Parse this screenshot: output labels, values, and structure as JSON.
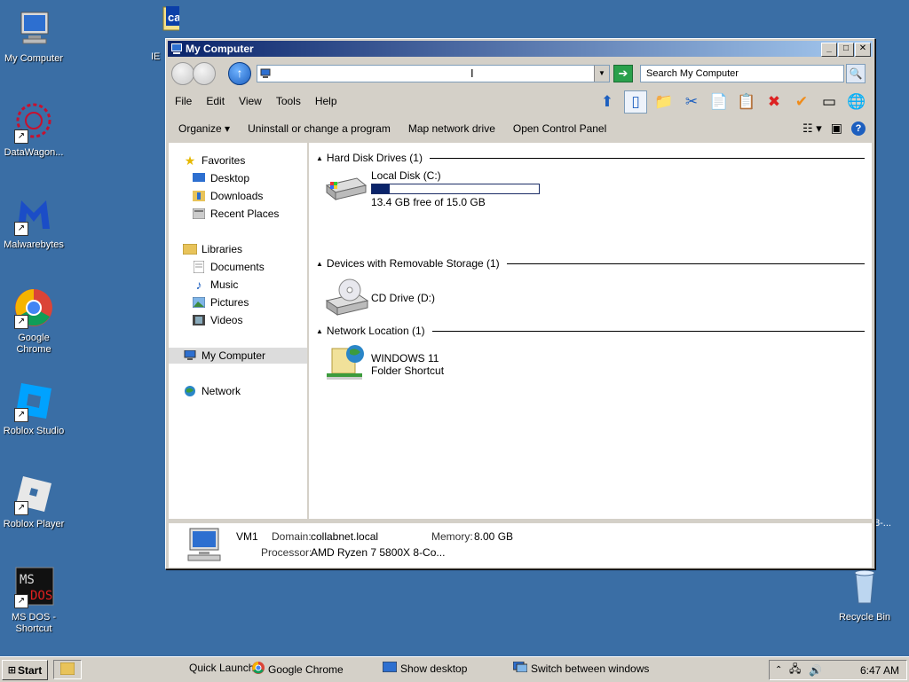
{
  "desktop": {
    "icons": [
      {
        "label": "My Computer"
      },
      {
        "label": "DataWagon..."
      },
      {
        "label": "Malwarebytes"
      },
      {
        "label": "Google Chrome"
      },
      {
        "label": "Roblox Studio"
      },
      {
        "label": "Roblox Player"
      },
      {
        "label": "MS DOS - Shortcut"
      },
      {
        "label": "IE"
      },
      {
        "label": "Recycle Bin"
      }
    ],
    "obscured_label": "8-..."
  },
  "window": {
    "title": "My Computer",
    "address": "",
    "search_placeholder": "Search My Computer",
    "menu": [
      "File",
      "Edit",
      "View",
      "Tools",
      "Help"
    ],
    "commands": [
      "Organize",
      "Uninstall or change a program",
      "Map network drive",
      "Open Control Panel"
    ],
    "nav": {
      "favorites": "Favorites",
      "desktop": "Desktop",
      "downloads": "Downloads",
      "recent": "Recent Places",
      "libraries": "Libraries",
      "documents": "Documents",
      "music": "Music",
      "pictures": "Pictures",
      "videos": "Videos",
      "my_computer": "My Computer",
      "network": "Network"
    },
    "groups": {
      "hdd": "Hard Disk Drives (1)",
      "removable": "Devices with Removable Storage (1)",
      "network": "Network Location (1)"
    },
    "drives": {
      "c_name": "Local Disk (C:)",
      "c_free": "13.4 GB free of 15.0 GB",
      "c_used_fraction": 0.107,
      "d_name": "CD Drive (D:)",
      "net_name": "WINDOWS 11",
      "net_type": "Folder Shortcut"
    },
    "status": {
      "computer": "VM1",
      "domain_label": "Domain:",
      "domain": "collabnet.local",
      "memory_label": "Memory:",
      "memory": "8.00 GB",
      "processor_label": "Processor:",
      "processor": "AMD Ryzen 7 5800X 8-Co..."
    }
  },
  "taskbar": {
    "start": "Start",
    "quick_launch": "Quick Launch",
    "chrome": "Google Chrome",
    "show_desktop": "Show desktop",
    "switch_windows": "Switch between windows",
    "time": "6:47 AM"
  }
}
